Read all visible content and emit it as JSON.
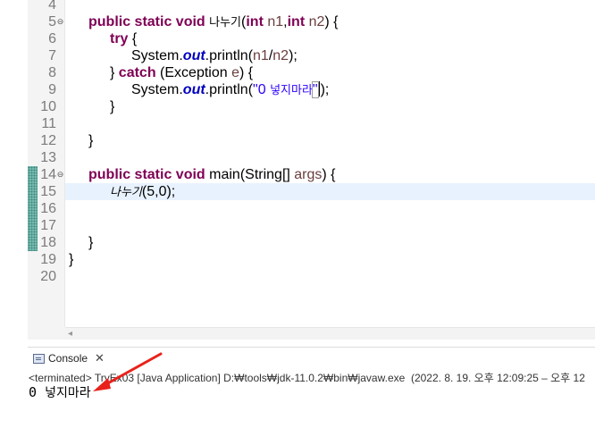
{
  "editor": {
    "line_numbers": [
      "4",
      "5",
      "6",
      "7",
      "8",
      "9",
      "10",
      "11",
      "12",
      "13",
      "14",
      "15",
      "16",
      "17",
      "18",
      "19",
      "20"
    ],
    "lines": {
      "l5": {
        "kw1": "public static void ",
        "name": "나누기",
        "paren": "(",
        "kw2": "int",
        "sp1": " ",
        "p1": "n1",
        "comma": ",",
        "kw3": "int",
        "sp2": " ",
        "p2": "n2",
        "end": ") {"
      },
      "l6": {
        "kw": "try",
        "rest": " {"
      },
      "l7": {
        "a": "System.",
        "fld": "out",
        "b": ".println(",
        "v1": "n1",
        "slash": "/",
        "v2": "n2",
        "c": ");"
      },
      "l8": {
        "a": "} ",
        "kw": "catch",
        "b": " (Exception ",
        "v": "e",
        "c": ") {"
      },
      "l9": {
        "a": "System.",
        "fld": "out",
        "b": ".println(",
        "str_open": "\"0 ",
        "str_ko": "넣지마라",
        "str_close": "\"",
        "c": ");"
      },
      "l10": {
        "text": "}"
      },
      "l12": {
        "text": "}"
      },
      "l14": {
        "kw": "public static void ",
        "a": "main(String[] ",
        "v": "args",
        "b": ") {"
      },
      "l15": {
        "call": "나누기",
        "args": "(5,0);"
      },
      "l18": {
        "text": "}"
      },
      "l19": {
        "text": "}"
      }
    }
  },
  "console": {
    "tab_label": "Console",
    "close_glyph": "✕",
    "status": "<terminated> TryEx03 [Java Application] D:₩tools₩jdk-11.0.2₩bin₩javaw.exe  (2022. 8. 19. 오후 12:09:25 – 오후 12",
    "output_prefix": "0 ",
    "output_ko": "넣지마라"
  },
  "annotation": {
    "arrow_color": "#e8221b"
  },
  "icons": {
    "fold_marker": "⊖",
    "scroll_left": "◂"
  }
}
